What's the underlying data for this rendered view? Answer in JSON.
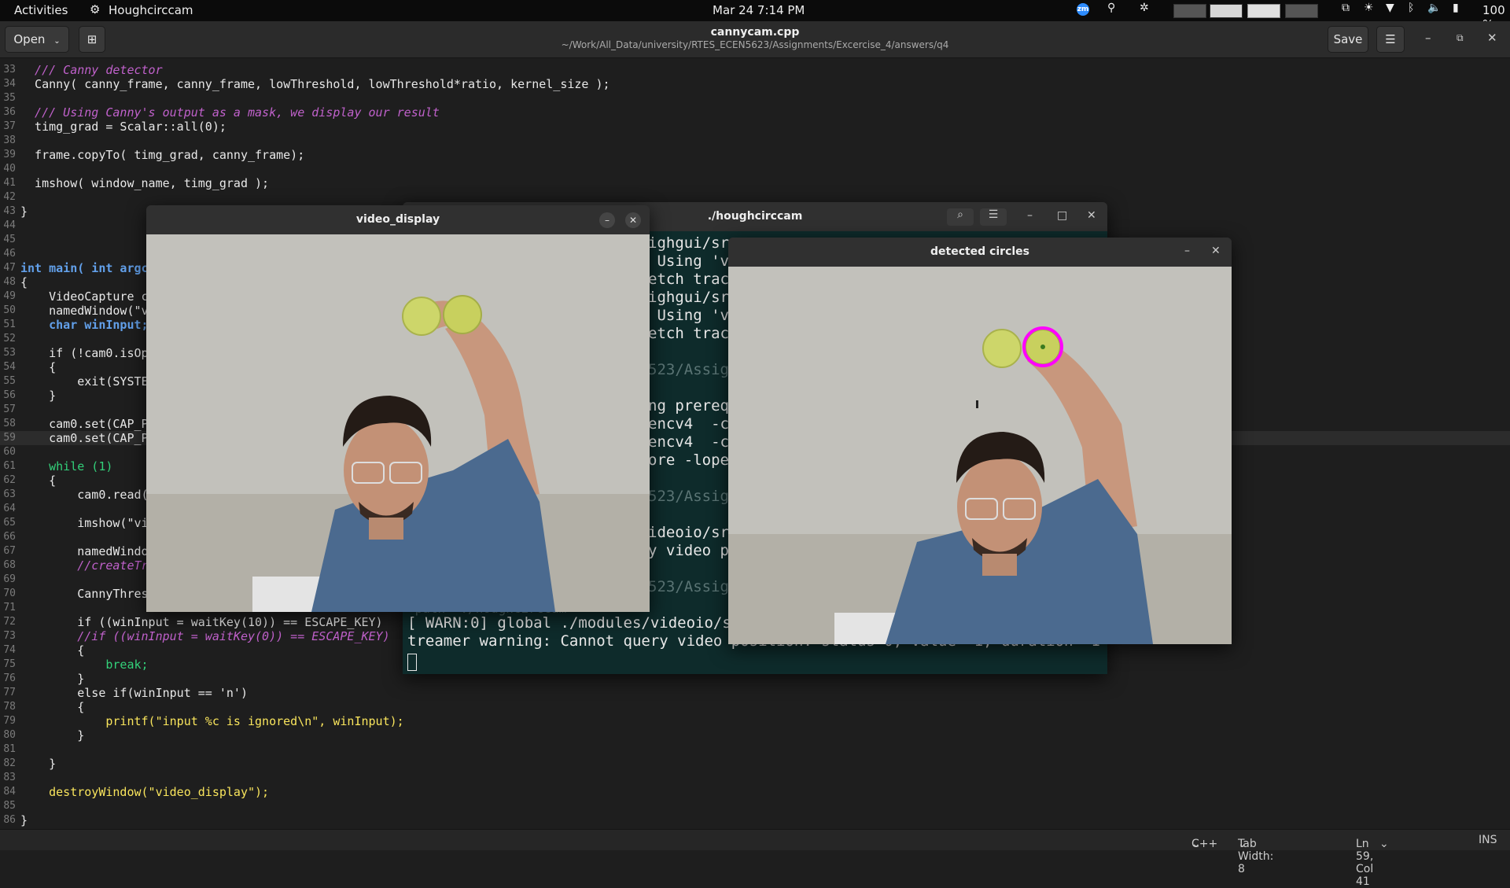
{
  "topbar": {
    "activities": "Activities",
    "app_name": "Houghcirccam",
    "clock": "Mar 24  7:14 PM",
    "battery": "100 %"
  },
  "gedit": {
    "open_label": "Open",
    "title": "cannycam.cpp",
    "path": "~/Work/All_Data/university/RTES_ECEN5623/Assignments/Excercise_4/answers/q4",
    "save_label": "Save"
  },
  "editor": {
    "lines": [
      {
        "n": "33",
        "t": "  /// Canny detector"
      },
      {
        "n": "34",
        "t": "  Canny( canny_frame, canny_frame, lowThreshold, lowThreshold*ratio, kernel_size );"
      },
      {
        "n": "35",
        "t": ""
      },
      {
        "n": "36",
        "t": "  /// Using Canny's output as a mask, we display our result"
      },
      {
        "n": "37",
        "t": "  timg_grad = Scalar::all(0);"
      },
      {
        "n": "38",
        "t": ""
      },
      {
        "n": "39",
        "t": "  frame.copyTo( timg_grad, canny_frame);"
      },
      {
        "n": "40",
        "t": ""
      },
      {
        "n": "41",
        "t": "  imshow( window_name, timg_grad );"
      },
      {
        "n": "42",
        "t": ""
      },
      {
        "n": "43",
        "t": "}"
      },
      {
        "n": "44",
        "t": ""
      },
      {
        "n": "45",
        "t": ""
      },
      {
        "n": "46",
        "t": ""
      },
      {
        "n": "47",
        "t": "int main( int argc"
      },
      {
        "n": "48",
        "t": "{"
      },
      {
        "n": "49",
        "t": "    VideoCapture ca"
      },
      {
        "n": "50",
        "t": "    namedWindow(\"vi"
      },
      {
        "n": "51",
        "t": "    char winInput;"
      },
      {
        "n": "52",
        "t": ""
      },
      {
        "n": "53",
        "t": "    if (!cam0.isOpe"
      },
      {
        "n": "54",
        "t": "    {"
      },
      {
        "n": "55",
        "t": "        exit(SYSTEM"
      },
      {
        "n": "56",
        "t": "    }"
      },
      {
        "n": "57",
        "t": ""
      },
      {
        "n": "58",
        "t": "    cam0.set(CAP_PF"
      },
      {
        "n": "59",
        "t": "    cam0.set(CAP_PF"
      },
      {
        "n": "60",
        "t": ""
      },
      {
        "n": "61",
        "t": "    while (1)"
      },
      {
        "n": "62",
        "t": "    {"
      },
      {
        "n": "63",
        "t": "        cam0.read(fr"
      },
      {
        "n": "64",
        "t": ""
      },
      {
        "n": "65",
        "t": "        imshow(\"vide"
      },
      {
        "n": "66",
        "t": ""
      },
      {
        "n": "67",
        "t": "        namedWindow("
      },
      {
        "n": "68",
        "t": "        //createTrac"
      },
      {
        "n": "69",
        "t": ""
      },
      {
        "n": "70",
        "t": "        CannyThresho"
      },
      {
        "n": "71",
        "t": ""
      },
      {
        "n": "72",
        "t": "        if ((winInput = waitKey(10)) == ESCAPE_KEY)"
      },
      {
        "n": "73",
        "t": "        //if ((winInput = waitKey(0)) == ESCAPE_KEY)"
      },
      {
        "n": "74",
        "t": "        {"
      },
      {
        "n": "75",
        "t": "            break;"
      },
      {
        "n": "76",
        "t": "        }"
      },
      {
        "n": "77",
        "t": "        else if(winInput == 'n')"
      },
      {
        "n": "78",
        "t": "        {"
      },
      {
        "n": "79",
        "t": "            printf(\"input %c is ignored\\n\", winInput);"
      },
      {
        "n": "80",
        "t": "        }"
      },
      {
        "n": "81",
        "t": ""
      },
      {
        "n": "82",
        "t": "    }"
      },
      {
        "n": "83",
        "t": ""
      },
      {
        "n": "84",
        "t": "    destroyWindow(\"video_display\");"
      },
      {
        "n": "85",
        "t": ""
      },
      {
        "n": "86",
        "t": "}"
      }
    ]
  },
  "statusbar": {
    "language": "C++",
    "tab_width": "Tab Width: 8",
    "position": "Ln 59, Col 41",
    "mode": "INS"
  },
  "video_display": {
    "title": "video_display"
  },
  "terminal": {
    "title": "./houghcirccam",
    "lines": [
      {
        "t": "ighgui/sr",
        "dim": false
      },
      {
        "t": " Using 'v",
        "dim": false
      },
      {
        "t": "etch track",
        "dim": false
      },
      {
        "t": "ighgui/sr",
        "dim": false
      },
      {
        "t": " Using 'v",
        "dim": false
      },
      {
        "t": "etch track",
        "dim": false
      },
      {
        "t": "",
        "dim": false
      },
      {
        "t": "523/Assig",
        "dim": true
      },
      {
        "t": "",
        "dim": false
      },
      {
        "t": "ng prereq",
        "dim": false
      },
      {
        "t": "encv4  -c",
        "dim": false
      },
      {
        "t": "encv4  -c",
        "dim": false
      },
      {
        "t": "ore -lope",
        "dim": false
      },
      {
        "t": "",
        "dim": false
      },
      {
        "t": "523/Assig",
        "dim": true
      },
      {
        "t": "",
        "dim": false
      },
      {
        "t": "ideoio/sr",
        "dim": false
      },
      {
        "t": "y video p",
        "dim": false
      },
      {
        "t": "",
        "dim": false
      },
      {
        "t": "523/Assig",
        "dim": true
      },
      {
        "t": " path  ./houghcirccam",
        "dim": true
      },
      {
        "t": "[ WARN:0] global ./modules/videoio/sr",
        "dim": false
      },
      {
        "t": "treamer warning: Cannot query video position: status=0, value=-1, duration=-1",
        "dim": false
      }
    ]
  },
  "detected": {
    "title": "detected circles"
  }
}
